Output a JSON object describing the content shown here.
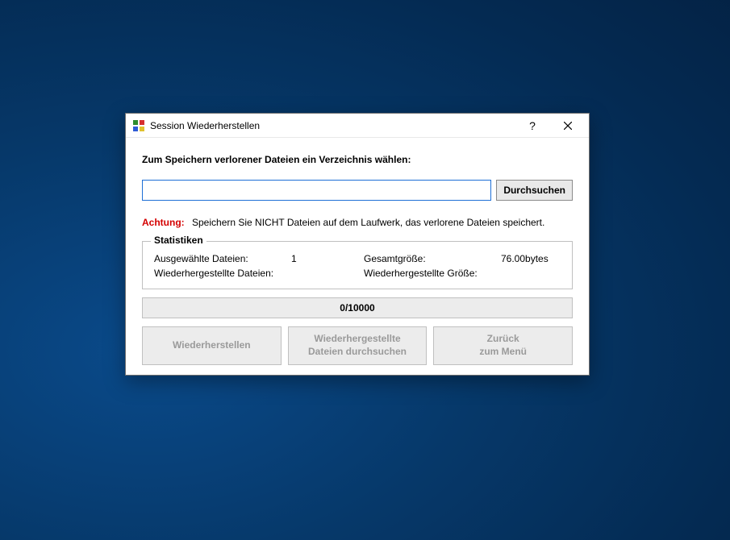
{
  "titlebar": {
    "title": "Session Wiederherstellen"
  },
  "content": {
    "prompt": "Zum Speichern verlorener Dateien ein Verzeichnis wählen:",
    "path_value": "",
    "browse_label": "Durchsuchen"
  },
  "warning": {
    "label": "Achtung:",
    "text": "Speichern Sie NICHT Dateien auf dem Laufwerk, das verlorene Dateien speichert."
  },
  "stats": {
    "legend": "Statistiken",
    "selected_files_label": "Ausgewählte Dateien:",
    "selected_files_value": "1",
    "total_size_label": "Gesamtgröße:",
    "total_size_value": "76.00bytes",
    "recovered_files_label": "Wiederhergestellte Dateien:",
    "recovered_files_value": "",
    "recovered_size_label": "Wiederhergestellte Größe:",
    "recovered_size_value": ""
  },
  "progress": {
    "text": "0/10000"
  },
  "buttons": {
    "recover_line1": "Wiederherstellen",
    "browse_recovered_line1": "Wiederhergestellte",
    "browse_recovered_line2": "Dateien durchsuchen",
    "back_line1": "Zurück",
    "back_line2": "zum Menü"
  }
}
